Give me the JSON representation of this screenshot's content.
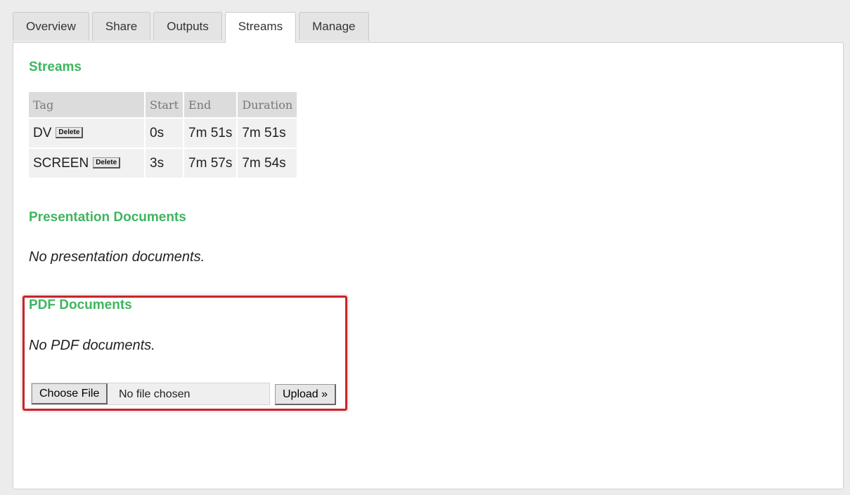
{
  "tabs": [
    {
      "label": "Overview",
      "active": false
    },
    {
      "label": "Share",
      "active": false
    },
    {
      "label": "Outputs",
      "active": false
    },
    {
      "label": "Streams",
      "active": true
    },
    {
      "label": "Manage",
      "active": false
    }
  ],
  "streams": {
    "title": "Streams",
    "columns": [
      "Tag",
      "Start",
      "End",
      "Duration"
    ],
    "rows": [
      {
        "tag": "DV",
        "delete_label": "Delete",
        "start": "0s",
        "end": "7m 51s",
        "duration": "7m 51s"
      },
      {
        "tag": "SCREEN",
        "delete_label": "Delete",
        "start": "3s",
        "end": "7m 57s",
        "duration": "7m 54s"
      }
    ]
  },
  "presentation": {
    "title": "Presentation Documents",
    "empty_text": "No presentation documents."
  },
  "pdf": {
    "title": "PDF Documents",
    "empty_text": "No PDF documents.",
    "choose_label": "Choose File",
    "file_status": "No file chosen",
    "upload_label": "Upload »"
  },
  "colors": {
    "section_title": "#3fb55f",
    "highlight_border": "#c7262b"
  }
}
